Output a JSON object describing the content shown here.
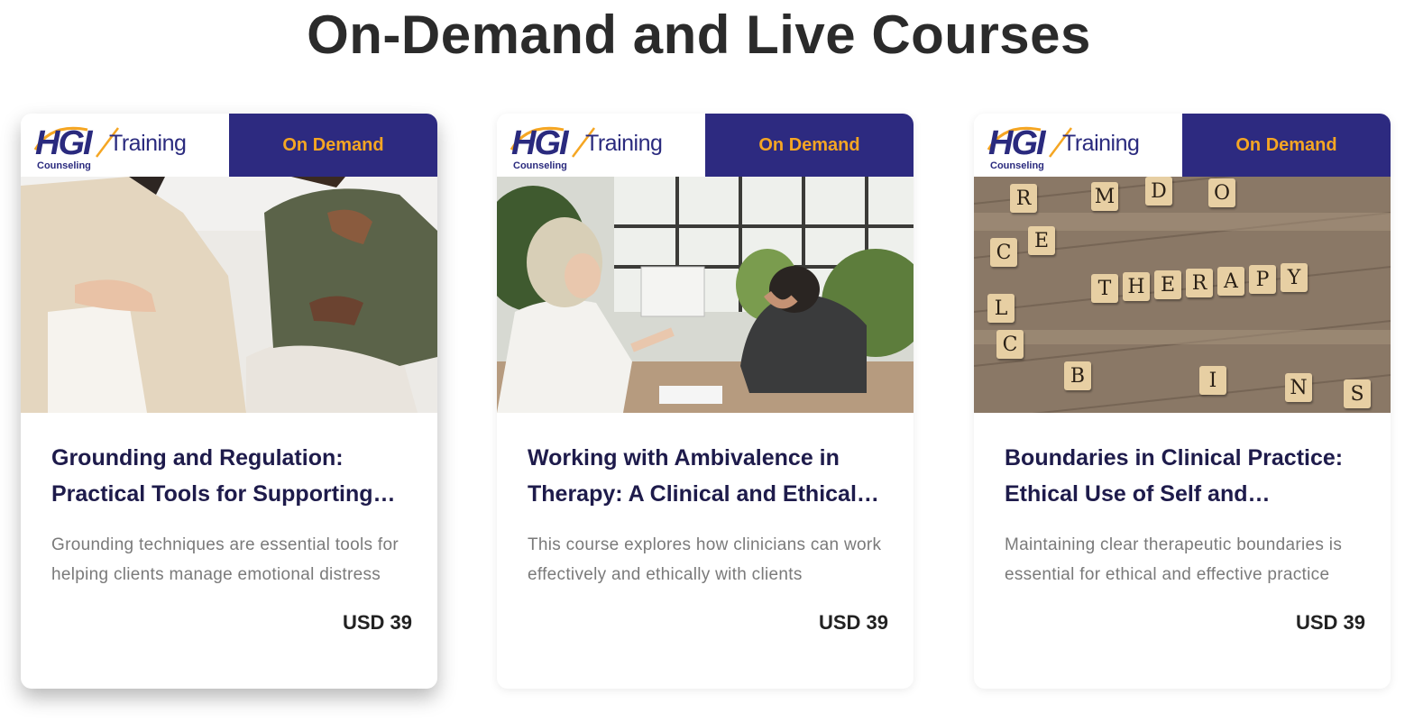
{
  "page": {
    "title": "On-Demand and Live Courses"
  },
  "brand": {
    "logo_text": "HGI",
    "training": "Training",
    "counseling": "Counseling",
    "color": "#2a2a7e"
  },
  "colors": {
    "badge_bg": "#2d2a80",
    "badge_text": "#f5a623",
    "title_text": "#1e1b4b"
  },
  "courses": [
    {
      "badge": "On Demand",
      "title": "Grounding and Regulation: Practical Tools for Supporting Clients",
      "description": "Grounding techniques are essential tools for helping clients manage emotional distress",
      "price": "USD 39",
      "image": "two-people-grounding-exercise-photo"
    },
    {
      "badge": "On Demand",
      "title": "Working with Ambivalence in Therapy: A Clinical and Ethical Approach",
      "description": "This course explores how clinicians can work effectively and ethically with clients",
      "price": "USD 39",
      "image": "therapy-session-photo"
    },
    {
      "badge": "On Demand",
      "title": "Boundaries in Clinical Practice: Ethical Use of Self and Disclosure",
      "description": "Maintaining clear therapeutic boundaries is essential for ethical and effective practice",
      "price": "USD 39",
      "image": "scrabble-therapy-tiles-photo",
      "tiles": [
        "T",
        "H",
        "E",
        "R",
        "A",
        "P",
        "Y"
      ]
    }
  ]
}
